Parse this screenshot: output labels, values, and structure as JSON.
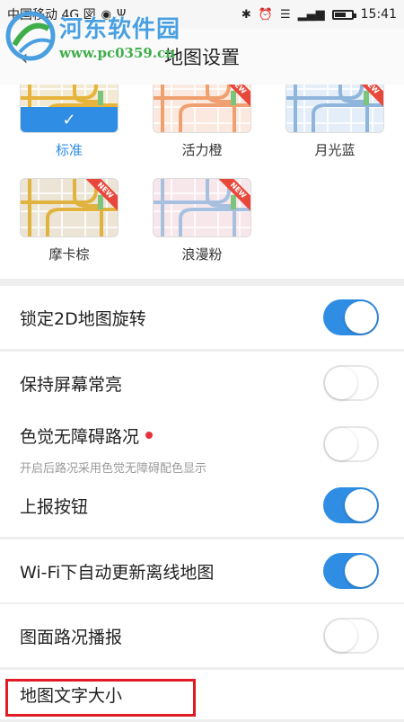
{
  "status_bar": {
    "carrier": "中国移动 4G 図",
    "time": "15:41"
  },
  "watermark": {
    "title": "河东软件园",
    "url": "www.pc0359.cn"
  },
  "header": {
    "title": "地图设置"
  },
  "themes": [
    {
      "label": "标准",
      "selected": true,
      "badge": "",
      "tint": "#f3ead4",
      "road": "#e6b43a"
    },
    {
      "label": "活力橙",
      "selected": false,
      "badge": "NEW",
      "tint": "#fbe9df",
      "road": "#f0a070"
    },
    {
      "label": "月光蓝",
      "selected": false,
      "badge": "NEW",
      "tint": "#e4eef8",
      "road": "#8fb5dc"
    },
    {
      "label": "摩卡棕",
      "selected": false,
      "badge": "NEW",
      "tint": "#ece4d4",
      "road": "#e0b23e"
    },
    {
      "label": "浪漫粉",
      "selected": false,
      "badge": "NEW",
      "tint": "#f7e6ea",
      "road": "#a8c0e0"
    }
  ],
  "settings": {
    "lock_2d": {
      "label": "锁定2D地图旋转",
      "on": true
    },
    "screen_on": {
      "label": "保持屏幕常亮",
      "on": false
    },
    "color_blind": {
      "label": "色觉无障碍路况",
      "sub": "开启后路况采用色觉无障碍配色显示",
      "on": false
    },
    "report_button": {
      "label": "上报按钮",
      "on": true
    },
    "wifi_update": {
      "label": "Wi-Fi下自动更新离线地图",
      "on": true
    },
    "traffic_broadcast": {
      "label": "图面路况播报",
      "on": false
    },
    "text_size": {
      "label": "地图文字大小"
    }
  },
  "colors": {
    "accent": "#2f8de4",
    "new_badge": "#e8483b",
    "highlight": "#e01b24"
  }
}
